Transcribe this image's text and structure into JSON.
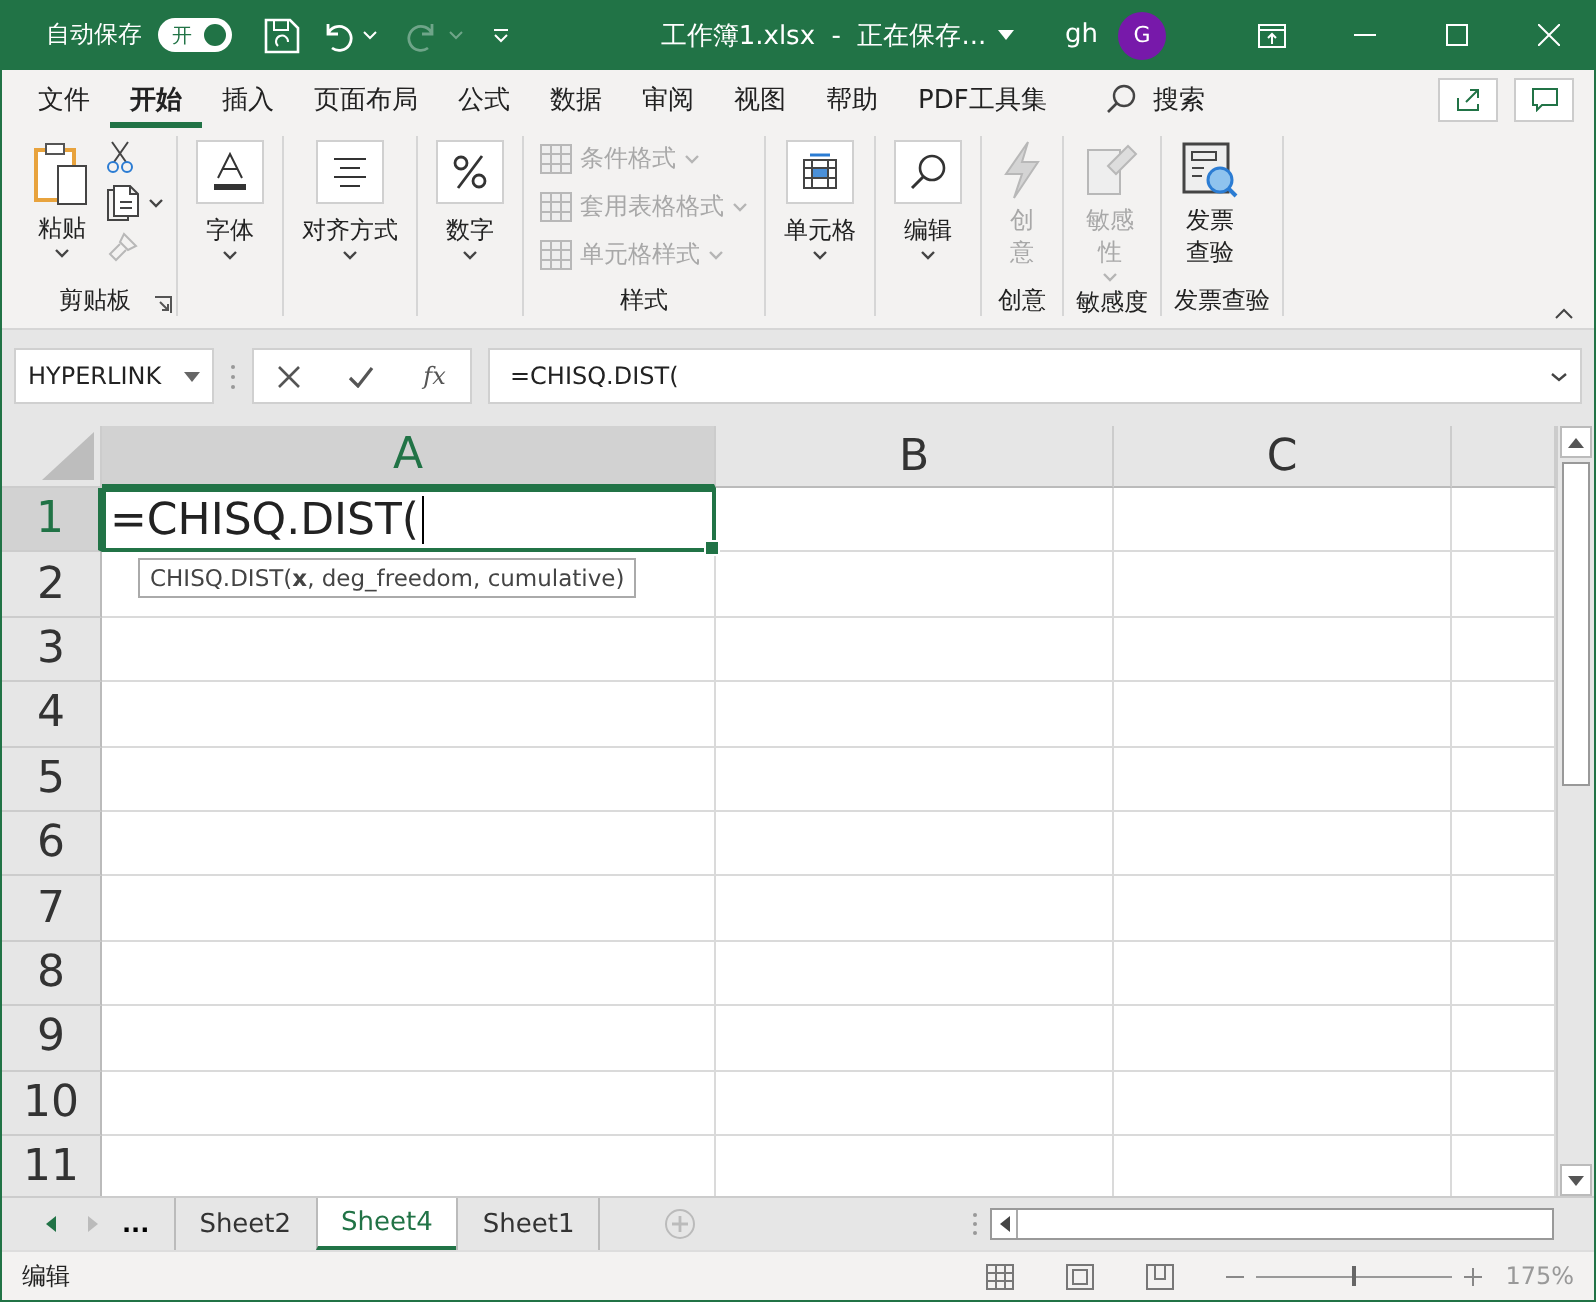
{
  "title_bar": {
    "autosave_label": "自动保存",
    "autosave_toggle": {
      "label": "开",
      "on": true
    },
    "title": "工作簿1.xlsx  -  正在保存...",
    "user": "gh",
    "avatar": "G"
  },
  "menu_tabs": [
    {
      "label": "文件",
      "selected": false
    },
    {
      "label": "开始",
      "selected": true
    },
    {
      "label": "插入",
      "selected": false
    },
    {
      "label": "页面布局",
      "selected": false
    },
    {
      "label": "公式",
      "selected": false
    },
    {
      "label": "数据",
      "selected": false
    },
    {
      "label": "审阅",
      "selected": false
    },
    {
      "label": "视图",
      "selected": false
    },
    {
      "label": "帮助",
      "selected": false
    },
    {
      "label": "PDF工具集",
      "selected": false
    }
  ],
  "search": {
    "label": "搜索"
  },
  "ribbon": {
    "groups": [
      {
        "label": "剪贴板",
        "launcher": true,
        "items": [
          {
            "kind": "large",
            "label": "粘贴",
            "dropdown": true,
            "disabled": false
          },
          {
            "kind": "icon",
            "dropdown": false,
            "disabled": false
          },
          {
            "kind": "icon",
            "dropdown": true,
            "disabled": false
          },
          {
            "kind": "icon",
            "dropdown": false,
            "disabled": true
          }
        ]
      },
      {
        "items": [
          {
            "kind": "collapsed",
            "label": "字体",
            "dropdown": true,
            "disabled": false
          }
        ]
      },
      {
        "items": [
          {
            "kind": "collapsed",
            "label": "对齐方式",
            "dropdown": true,
            "disabled": false
          }
        ]
      },
      {
        "items": [
          {
            "kind": "collapsed",
            "label": "数字",
            "dropdown": true,
            "disabled": false
          }
        ]
      },
      {
        "label": "样式",
        "items": [
          {
            "kind": "small",
            "label": "条件格式",
            "dropdown": true,
            "disabled": true
          },
          {
            "kind": "small",
            "label": "套用表格格式",
            "dropdown": true,
            "disabled": true
          },
          {
            "kind": "small",
            "label": "单元格样式",
            "dropdown": true,
            "disabled": true
          }
        ]
      },
      {
        "items": [
          {
            "kind": "collapsed",
            "label": "单元格",
            "dropdown": true,
            "disabled": false
          }
        ]
      },
      {
        "items": [
          {
            "kind": "collapsed",
            "label": "编辑",
            "dropdown": true,
            "disabled": false
          }
        ]
      },
      {
        "label": "创意",
        "items": [
          {
            "kind": "large",
            "label": "创意",
            "dropdown": false,
            "disabled": true
          }
        ]
      },
      {
        "label": "敏感度",
        "items": [
          {
            "kind": "large",
            "label": "敏感性",
            "dropdown": true,
            "disabled": true
          }
        ]
      },
      {
        "label": "发票查验",
        "items": [
          {
            "kind": "large",
            "label": "发票查验",
            "dropdown": false,
            "disabled": false
          }
        ]
      }
    ]
  },
  "formula_bar": {
    "name_box": "HYPERLINK",
    "fx": "fx",
    "formula": "=CHISQ.DIST("
  },
  "sheet": {
    "columns": [
      {
        "label": "A",
        "selected": true
      },
      {
        "label": "B",
        "selected": false
      },
      {
        "label": "C",
        "selected": false
      }
    ],
    "rows": [
      {
        "label": "1",
        "selected": true
      },
      {
        "label": "2",
        "selected": false
      },
      {
        "label": "3",
        "selected": false
      },
      {
        "label": "4",
        "selected": false
      },
      {
        "label": "5",
        "selected": false
      },
      {
        "label": "6",
        "selected": false
      },
      {
        "label": "7",
        "selected": false
      },
      {
        "label": "8",
        "selected": false
      },
      {
        "label": "9",
        "selected": false
      },
      {
        "label": "10",
        "selected": false
      },
      {
        "label": "11",
        "selected": false
      }
    ],
    "active_cell": "=CHISQ.DIST(",
    "tooltip": "CHISQ.DIST(**x**, deg_freedom, cumulative)"
  },
  "sheet_tabs": {
    "more": "...",
    "tabs": [
      {
        "label": "Sheet2",
        "selected": false
      },
      {
        "label": "Sheet4",
        "selected": true
      },
      {
        "label": "Sheet1",
        "selected": false
      }
    ]
  },
  "status_bar": {
    "mode": "编辑",
    "zoom": {
      "label": "175%",
      "level": 0.5
    }
  }
}
